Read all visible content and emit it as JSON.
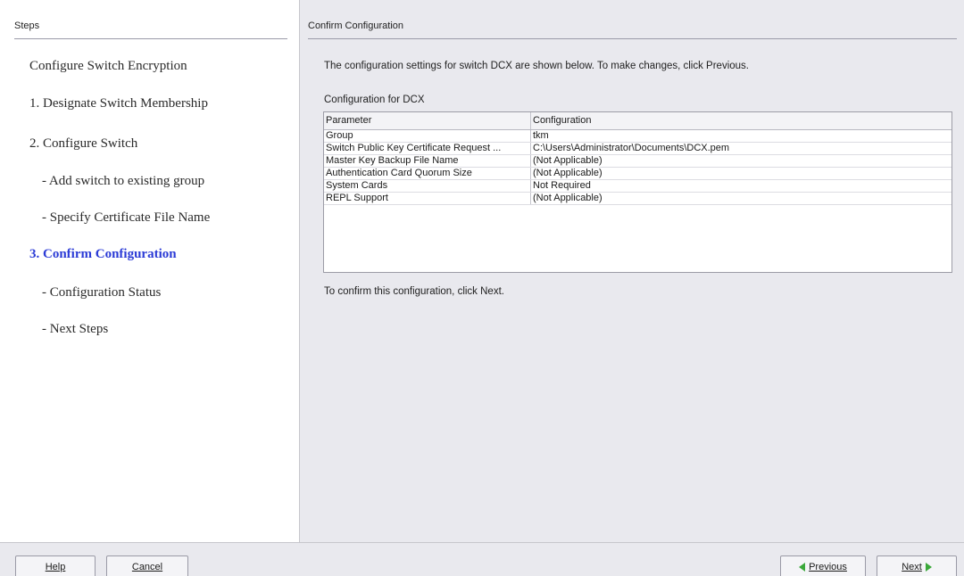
{
  "steps_panel": {
    "header": "Steps",
    "items": [
      {
        "label": "Configure Switch Encryption"
      },
      {
        "label": "1. Designate Switch Membership"
      },
      {
        "label": "2. Configure Switch"
      },
      {
        "label": "- Add switch to existing group"
      },
      {
        "label": "- Specify Certificate File Name"
      },
      {
        "label": "3. Confirm Configuration"
      },
      {
        "label": "- Configuration Status"
      },
      {
        "label": "- Next Steps"
      }
    ],
    "current_step_color": "#2b3bd6"
  },
  "main_panel": {
    "header": "Confirm Configuration",
    "intro": "The configuration settings for switch DCX are shown below. To make changes, click Previous.",
    "config_title": "Configuration for DCX",
    "table": {
      "columns": [
        "Parameter",
        "Configuration"
      ],
      "rows": [
        [
          "Group",
          "tkm"
        ],
        [
          "Switch Public Key Certificate Request ...",
          "C:\\Users\\Administrator\\Documents\\DCX.pem"
        ],
        [
          "Master Key Backup File Name",
          "(Not Applicable)"
        ],
        [
          "Authentication Card Quorum Size",
          "(Not Applicable)"
        ],
        [
          "System Cards",
          "Not Required"
        ],
        [
          "REPL Support",
          "(Not Applicable)"
        ]
      ]
    },
    "confirm_text": "To confirm this configuration, click Next."
  },
  "footer": {
    "help_label": "Help",
    "cancel_label": "Cancel",
    "previous_label": "Previous",
    "next_label": "Next",
    "nav_arrow_color": "#3aa83a"
  }
}
